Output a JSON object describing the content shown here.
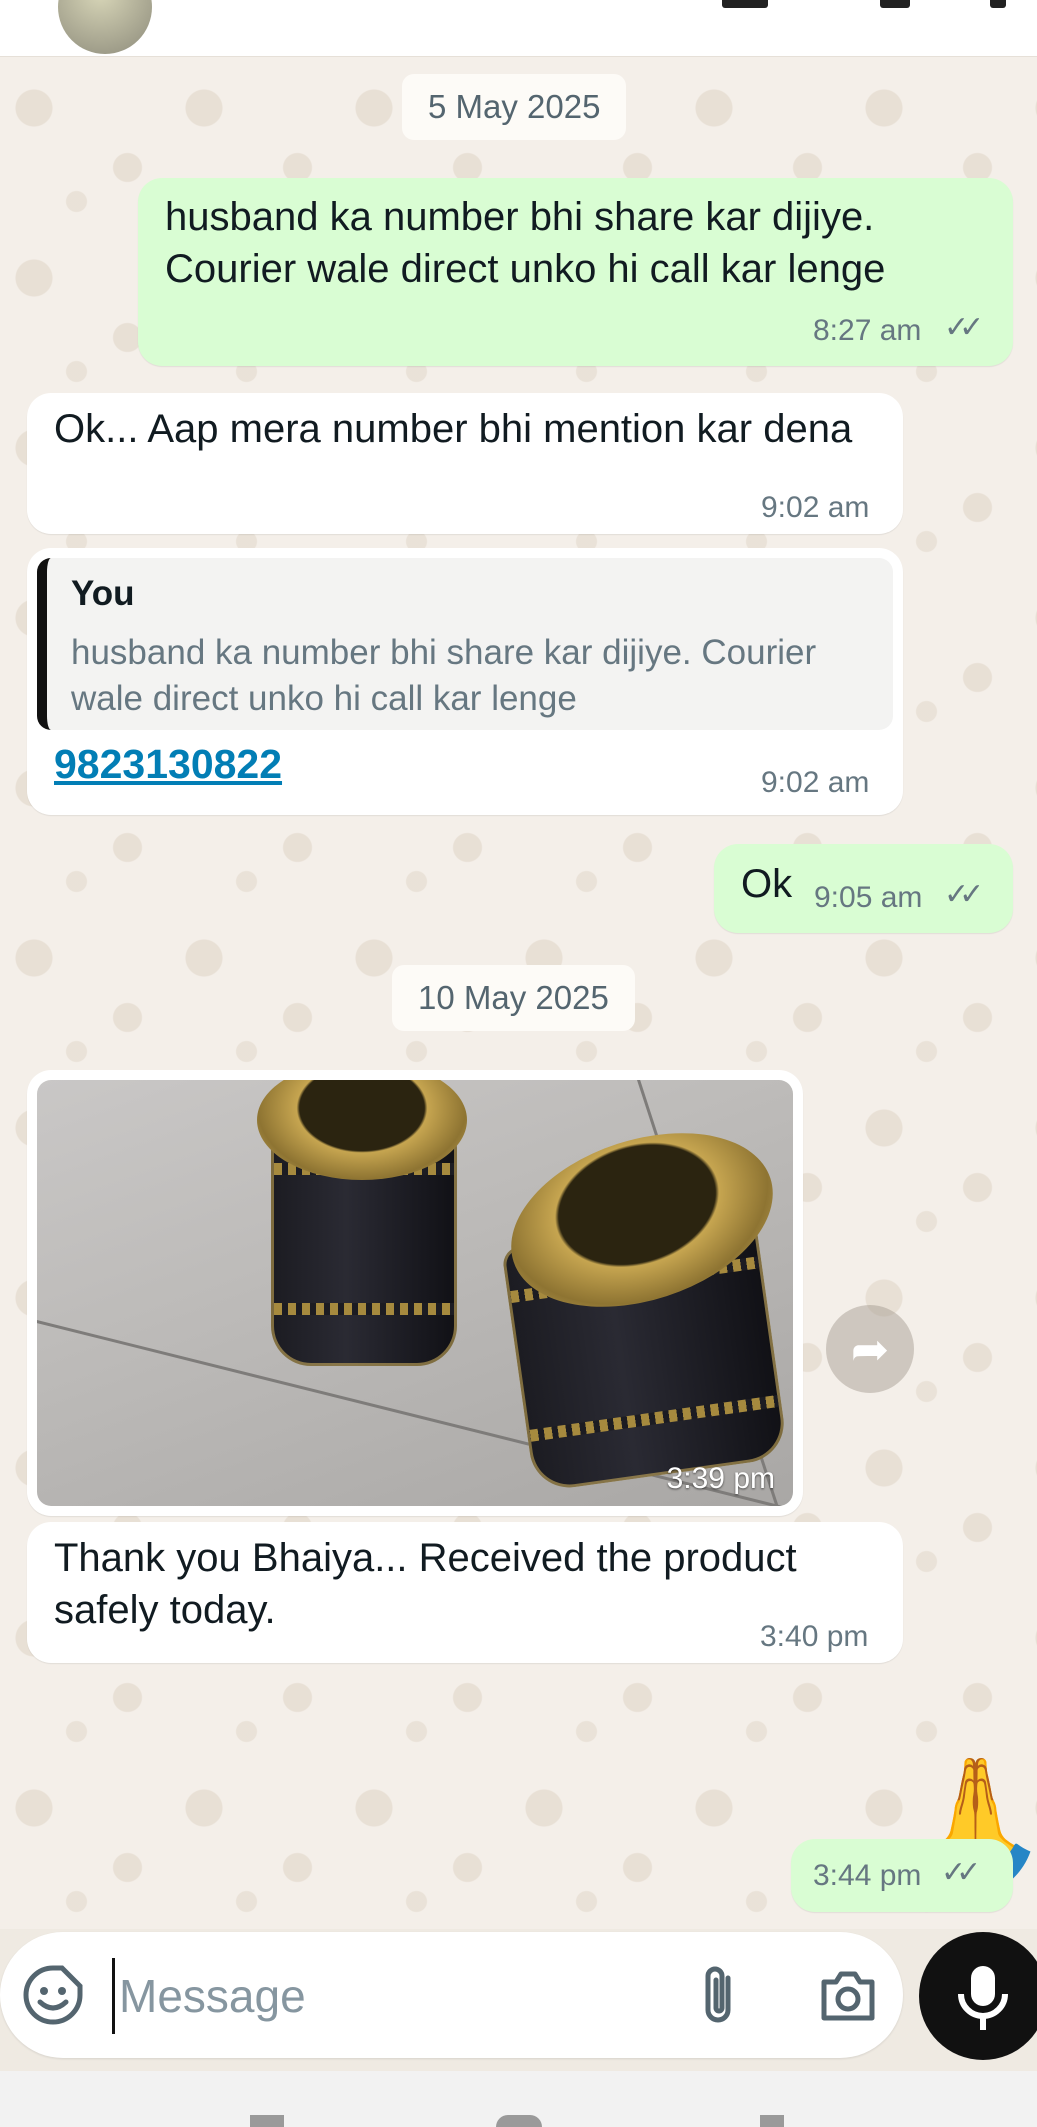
{
  "dates": {
    "first": "5 May 2025",
    "second": "10 May 2025"
  },
  "messages": {
    "m1": {
      "text": "husband ka number bhi share kar dijiye. Courier wale direct unko hi call kar lenge",
      "time": "8:27 am",
      "ticks": "✓✓"
    },
    "m2": {
      "text": "Ok... Aap mera number bhi mention kar dena",
      "time": "9:02 am"
    },
    "m3": {
      "quote_author": "You",
      "quote_text": "husband ka number bhi share kar dijiye. Courier wale direct unko hi call kar lenge",
      "phone": "9823130822",
      "time": "9:02 am"
    },
    "m4": {
      "text": "Ok",
      "time": "9:05 am",
      "ticks": "✓✓"
    },
    "m5": {
      "photo_time": "3:39 pm"
    },
    "m6": {
      "text": "Thank you Bhaiya... Received the product safely today.",
      "time": "3:40 pm"
    },
    "m7": {
      "emoji": "🙏",
      "time": "3:44 pm",
      "ticks": "✓✓"
    }
  },
  "composer": {
    "placeholder": "Message"
  },
  "icons": {
    "emoji_sticker": "sticker-smile-icon",
    "attach": "paperclip-icon",
    "camera": "camera-icon",
    "mic": "microphone-icon",
    "forward": "forward-icon"
  },
  "colors": {
    "outgoing_bubble": "#d9fdd3",
    "incoming_bubble": "#ffffff",
    "link": "#027eb5",
    "mic_button": "#111111"
  }
}
